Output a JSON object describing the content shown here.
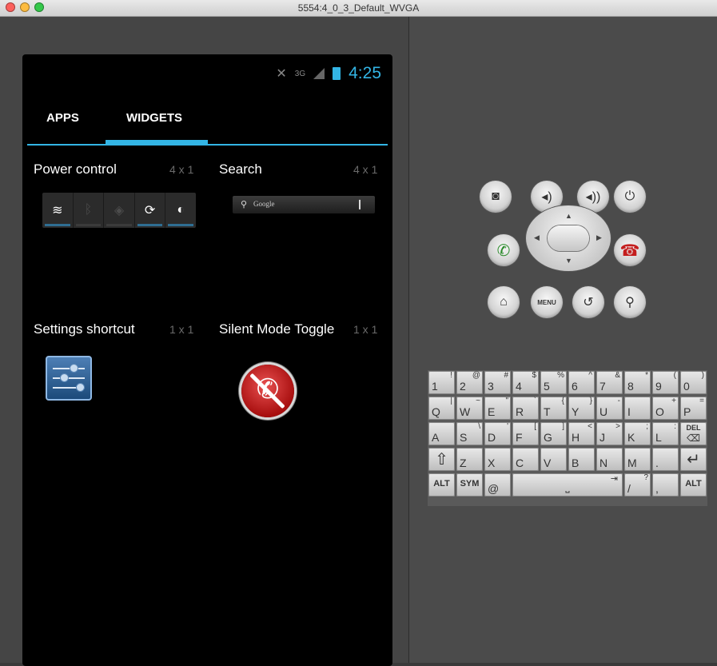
{
  "window": {
    "title": "5554:4_0_3_Default_WVGA"
  },
  "status_bar": {
    "time": "4:25",
    "network": "3G"
  },
  "tabs": [
    {
      "label": "APPS",
      "selected": false
    },
    {
      "label": "WIDGETS",
      "selected": true
    }
  ],
  "widgets": [
    {
      "name": "Power control",
      "size": "4 x 1"
    },
    {
      "name": "Search",
      "size": "4 x 1"
    },
    {
      "name": "Settings shortcut",
      "size": "1 x 1"
    },
    {
      "name": "Silent Mode Toggle",
      "size": "1 x 1"
    }
  ],
  "search_widget": {
    "brand": "Google"
  },
  "power_control": {
    "buttons": [
      {
        "icon": "wifi-icon",
        "on": true
      },
      {
        "icon": "bluetooth-icon",
        "on": false
      },
      {
        "icon": "gps-icon",
        "on": false
      },
      {
        "icon": "sync-icon",
        "on": true
      },
      {
        "icon": "brightness-icon",
        "on": true
      }
    ]
  },
  "controls": {
    "menu_label": "MENU"
  },
  "keyboard": {
    "row1": [
      {
        "main": "1",
        "sub": "!"
      },
      {
        "main": "2",
        "sub": "@"
      },
      {
        "main": "3",
        "sub": "#"
      },
      {
        "main": "4",
        "sub": "$"
      },
      {
        "main": "5",
        "sub": "%"
      },
      {
        "main": "6",
        "sub": "^"
      },
      {
        "main": "7",
        "sub": "&"
      },
      {
        "main": "8",
        "sub": "*"
      },
      {
        "main": "9",
        "sub": "("
      },
      {
        "main": "0",
        "sub": ")"
      }
    ],
    "row2": [
      {
        "main": "Q",
        "sub": "|"
      },
      {
        "main": "W",
        "sub": "~"
      },
      {
        "main": "E",
        "sub": "\""
      },
      {
        "main": "R",
        "sub": "`"
      },
      {
        "main": "T",
        "sub": "{"
      },
      {
        "main": "Y",
        "sub": "}"
      },
      {
        "main": "U",
        "sub": "-"
      },
      {
        "main": "I",
        "sub": ""
      },
      {
        "main": "O",
        "sub": "+"
      },
      {
        "main": "P",
        "sub": "="
      }
    ],
    "row3": [
      {
        "main": "A",
        "sub": ""
      },
      {
        "main": "S",
        "sub": "\\"
      },
      {
        "main": "D",
        "sub": "'"
      },
      {
        "main": "F",
        "sub": "["
      },
      {
        "main": "G",
        "sub": "]"
      },
      {
        "main": "H",
        "sub": "<"
      },
      {
        "main": "J",
        "sub": ">"
      },
      {
        "main": "K",
        "sub": ";"
      },
      {
        "main": "L",
        "sub": ":"
      }
    ],
    "del_label": "DEL",
    "row4": [
      {
        "main": "Z",
        "sub": ""
      },
      {
        "main": "X",
        "sub": ""
      },
      {
        "main": "C",
        "sub": ""
      },
      {
        "main": "V",
        "sub": ""
      },
      {
        "main": "B",
        "sub": ""
      },
      {
        "main": "N",
        "sub": ""
      },
      {
        "main": "M",
        "sub": ""
      },
      {
        "main": ".",
        "sub": ""
      }
    ],
    "alt_label": "ALT",
    "sym_label": "SYM",
    "at_label": "@",
    "slash_key": {
      "main": "/",
      "sub": "?"
    },
    "comma_key": ","
  }
}
